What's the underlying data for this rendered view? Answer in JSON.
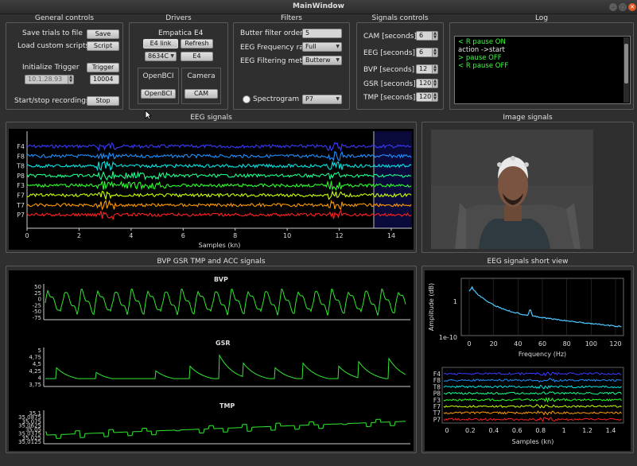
{
  "window": {
    "title": "MainWindow",
    "buttons": [
      "–",
      "▢",
      "✕"
    ]
  },
  "general": {
    "title": "General controls",
    "save_label": "Save trials to file",
    "save_btn": "Save",
    "load_label": "Load custom scripts",
    "load_btn": "Script",
    "trigger_label": "Initialize Trigger",
    "trigger_btn": "Trigger",
    "ip_value": "10.1.28.93",
    "port_value": "10004",
    "record_label": "Start/stop recordings",
    "stop_btn": "Stop"
  },
  "drivers": {
    "title": "Drivers",
    "empatica_label": "Empatica E4",
    "link_btn": "E4 link",
    "refresh_btn": "Refresh",
    "device_value": "8634C",
    "e4_btn": "E4",
    "openbci_label": "OpenBCI",
    "openbci_btn": "OpenBCI",
    "camera_label": "Camera",
    "cam_btn": "CAM"
  },
  "filters": {
    "title": "Filters",
    "order_label": "Butter filter order",
    "order_value": "5",
    "range_label": "EEG Frequency rar",
    "range_value": "Full",
    "method_label": "EEG Filtering meth",
    "method_value": "Butterw",
    "spectrogram_label": "Spectrogram",
    "channel_value": "P7"
  },
  "signals": {
    "title": "Signals controls",
    "rows": [
      {
        "label": "CAM [seconds]",
        "value": "6"
      },
      {
        "label": "EEG [seconds]",
        "value": "6"
      },
      {
        "label": "BVP [seconds]",
        "value": "12"
      },
      {
        "label": "GSR [seconds]",
        "value": "120"
      },
      {
        "label": "TMP [seconds]",
        "value": "120"
      }
    ]
  },
  "log": {
    "title": "Log",
    "lines": [
      {
        "text": "< R pause ON",
        "color": "#3cff3c"
      },
      {
        "text": "action ->start",
        "color": "#e8e8e8"
      },
      {
        "text": "> pause OFF",
        "color": "#3cff3c"
      },
      {
        "text": "< R pause OFF",
        "color": "#3cff3c"
      }
    ]
  },
  "eeg": {
    "title": "EEG signals",
    "channels": [
      "F4",
      "F8",
      "T8",
      "P8",
      "F3",
      "F7",
      "T7",
      "P7"
    ],
    "colors": [
      "#3a3aff",
      "#1e90ff",
      "#00e5e5",
      "#19ff8c",
      "#2aff2a",
      "#c8ff00",
      "#ff9900",
      "#ff2020"
    ],
    "xticks": [
      "0",
      "2",
      "4",
      "6",
      "8",
      "10",
      "12",
      "14"
    ],
    "xlabel": "Samples (kn)"
  },
  "image": {
    "title": "Image signals"
  },
  "bvpgsr": {
    "title": "BVP GSR TMP and ACC signals",
    "bvp": {
      "title": "BVP",
      "ticks": [
        "50",
        "25",
        "0",
        "-25",
        "-50",
        "-75"
      ]
    },
    "gsr": {
      "title": "GSR",
      "ticks": [
        "5",
        "4,75",
        "4,5",
        "4,25",
        "4",
        "3,75"
      ]
    },
    "tmp": {
      "title": "TMP",
      "ticks": [
        "35,1",
        "35,0875",
        "35,075",
        "35,0625",
        "35,05",
        "35,0375",
        "35,025",
        "35,0125"
      ]
    }
  },
  "short": {
    "title": "EEG signals short view",
    "ylabel": "Amplitude (dB)",
    "yticks": [
      "1",
      "1e-10"
    ],
    "xticks": [
      "0",
      "20",
      "40",
      "60",
      "80",
      "100",
      "120"
    ],
    "xlabel": "Frequency (Hz)",
    "channels": [
      "F4",
      "F8",
      "T8",
      "P8",
      "F3",
      "F7",
      "T7",
      "P7"
    ],
    "xticks2": [
      "0",
      "0.2",
      "0.4",
      "0.6",
      "0.8",
      "1",
      "1.2",
      "1.4"
    ],
    "xlabel2": "Samples (kn)"
  },
  "cursor": "mouse-pointer-icon"
}
